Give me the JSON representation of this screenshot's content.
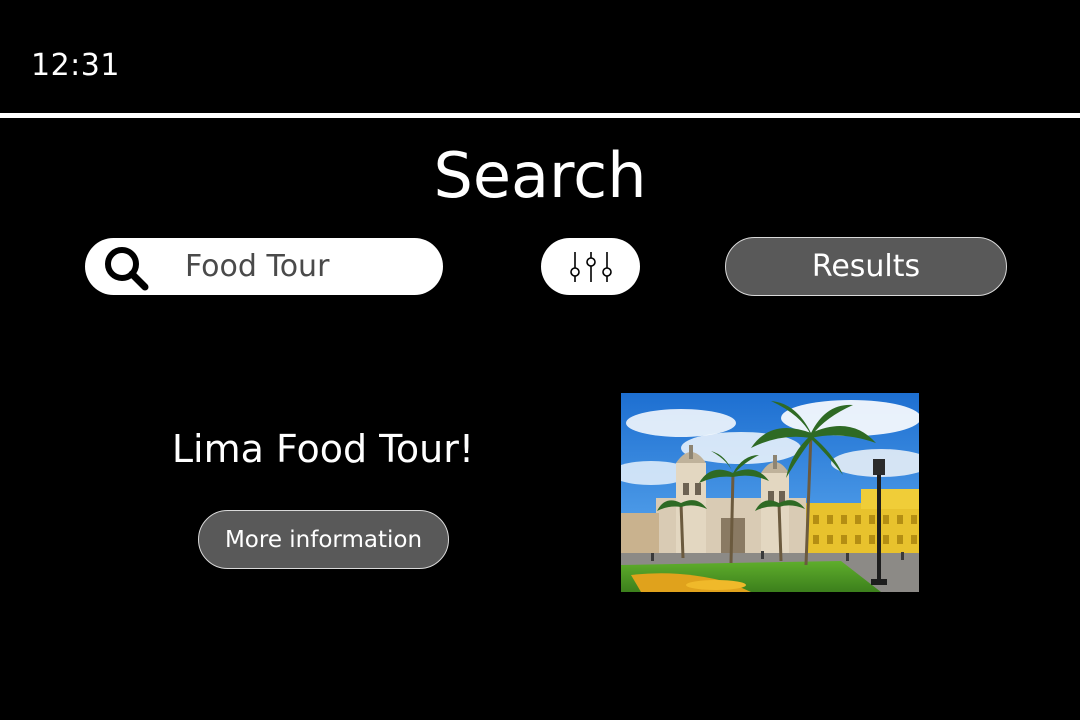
{
  "status_bar": {
    "time": "12:31"
  },
  "page": {
    "title": "Search"
  },
  "search": {
    "value": "Food Tour",
    "icon": "search-icon"
  },
  "filter": {
    "icon": "sliders-icon"
  },
  "results_button": {
    "label": "Results"
  },
  "result": {
    "title": "Lima Food Tour!",
    "more_info_label": "More information",
    "photo": "plaza-cathedral-photo"
  },
  "colors": {
    "background": "#000000",
    "foreground": "#ffffff",
    "button_fill": "#595959",
    "input_text": "#4a4a4a"
  }
}
